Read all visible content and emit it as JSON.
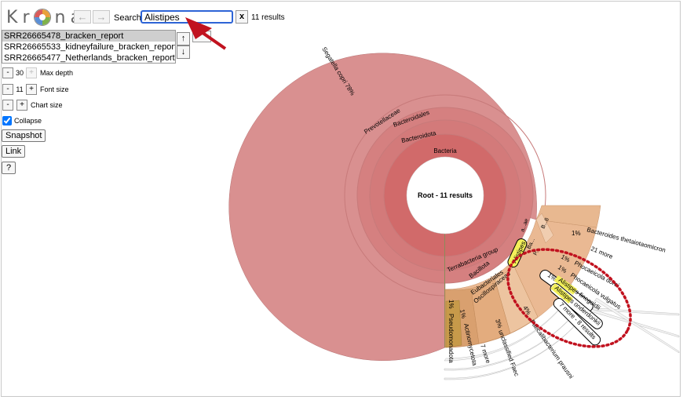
{
  "logo": {
    "letters": [
      "K",
      "r",
      "n",
      "a"
    ]
  },
  "nav": {
    "back": "←",
    "forward": "→"
  },
  "search": {
    "label": "Search:",
    "value": "Alistipes",
    "clear": "x",
    "results": "11 results"
  },
  "datasets": [
    "SRR26665478_bracken_report",
    "SRR26665533_kidneyfailure_bracken_report",
    "SRR26665477_Netherlands_bracken_report"
  ],
  "dataset_nav": {
    "up": "↑",
    "down": "↓"
  },
  "controls": {
    "depth": {
      "minus": "-",
      "value": "30",
      "plus": "+",
      "label": "Max depth"
    },
    "font": {
      "minus": "-",
      "value": "11",
      "plus": "+",
      "label": "Font size"
    },
    "chart": {
      "minus": "-",
      "plus": "+",
      "label": "Chart size"
    },
    "collapse": {
      "label": "Collapse",
      "checked": true
    }
  },
  "buttons": {
    "snapshot": "Snapshot",
    "link": "Link",
    "help": "?"
  },
  "chart": {
    "center_label": "Root - 11 results",
    "labels": {
      "segatella": "Segatella copri 78%",
      "prevotellaceae": "Prevotellaceae",
      "bacteroidales": "Bacteroidales",
      "bacteroidota": "Bacteroidota",
      "bacteria": "Bacteria",
      "terrabacteria": "Terrabacteria group",
      "bacillota": "Bacillota",
      "eubacteriales": "Eubacteriales",
      "oscillospiraceae": "Oscillospiraceae",
      "pseudomonadota": "Pseudomonadota",
      "actinomycetota": "Actinomycetota",
      "pct1a": "1%",
      "pct1b": "1%",
      "pct3": "3%",
      "pct4": "4%",
      "unclassified": "unclassified Faec",
      "faecali": "Faecalibacterium prausni",
      "seven_more": "7 more",
      "alistipes": "Alistipes",
      "b8": "B...8",
      "ae": "a...ae",
      "p": "P...",
      "ba": "Ba...",
      "thetaiot": "Bacteroides thetaiotaomicron",
      "thetaiot_pct": "1%",
      "more21": "21 more",
      "phocaeicola_dorei": "Phocaeicola dorei",
      "dorei_pct": "1%",
      "phocaeicola_vulgatus": "Phocaeicola vulgatus",
      "vulgatus_pct": "1%",
      "alistipes_finegoldii": "Alistipes finegoldii",
      "finegoldii_pct": "1%",
      "alistipes_onderdonkii": "Alistipes onderdonkii",
      "more_results": "7 more - 8 results"
    }
  },
  "colors": {
    "main_red": "#d99090",
    "inner_red": "#d16a6a",
    "tan": "#e8b48c",
    "highlight": "#f3f05a",
    "annotation": "#c1121f"
  }
}
